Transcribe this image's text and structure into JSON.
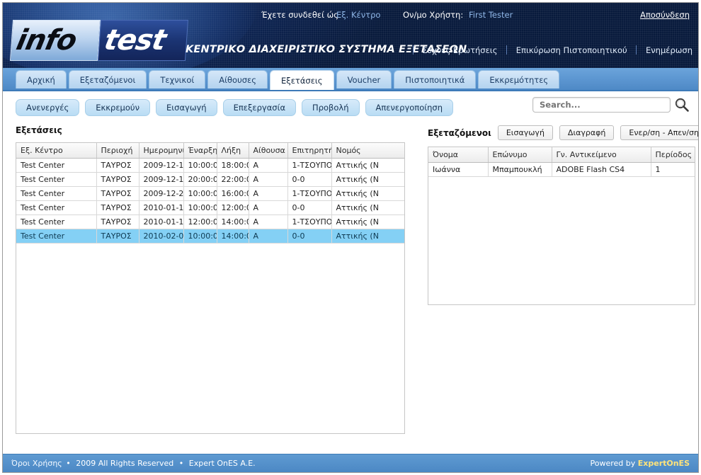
{
  "header": {
    "logo": {
      "part1": "info",
      "part2": "test"
    },
    "system_title": "ΚΕΝΤΡΙΚΟ ΔΙΑΧΕΙΡΙΣΤΙΚΟ ΣΥΣΤΗΜΑ ΕΞΕΤΑΣΕΩΝ",
    "connected_as_label": "Έχετε συνδεθεί ώς",
    "connected_as_value": "Εξ. Κέντρο",
    "username_label": "Ον/μο Χρήστη:",
    "username_value": "First Tester",
    "logout_label": "Αποσύνδεση",
    "links": [
      {
        "label": "Συχνές Ερωτήσεις"
      },
      {
        "label": "Επικύρωση Πιστοποιητικού"
      },
      {
        "label": "Ενημέρωση"
      }
    ]
  },
  "tabs": [
    {
      "label": "Αρχική",
      "active": false
    },
    {
      "label": "Εξεταζόμενοι",
      "active": false
    },
    {
      "label": "Τεχνικοί",
      "active": false
    },
    {
      "label": "Αίθουσες",
      "active": false
    },
    {
      "label": "Εξετάσεις",
      "active": true
    },
    {
      "label": "Voucher",
      "active": false
    },
    {
      "label": "Πιστοποιητικά",
      "active": false
    },
    {
      "label": "Εκκρεμότητες",
      "active": false
    }
  ],
  "toolbar": {
    "buttons": [
      {
        "label": "Ανενεργές"
      },
      {
        "label": "Εκκρεμούν"
      },
      {
        "label": "Εισαγωγή"
      },
      {
        "label": "Επεξεργασία"
      },
      {
        "label": "Προβολή"
      },
      {
        "label": "Απενεργοποίηση"
      }
    ]
  },
  "search": {
    "placeholder": "Search...",
    "value": "",
    "icon": "search-icon"
  },
  "exams_panel": {
    "title": "Εξετάσεις",
    "columns": [
      "Εξ. Κέντρο",
      "Περιοχή",
      "Ημερομηνί",
      "Έναρξη",
      "Λήξη",
      "Αίθουσα",
      "Επιτηρητής",
      "Νομός"
    ],
    "rows": [
      {
        "center": "Test Center",
        "area": "ΤΑΥΡΟΣ",
        "date": "2009-12-1",
        "start": "10:00:0",
        "end": "18:00:0",
        "room": "Α",
        "supervisor": "1-ΤΣΟΥΠΟ",
        "prefecture": "Αττικής (Ν",
        "selected": false
      },
      {
        "center": "Test Center",
        "area": "ΤΑΥΡΟΣ",
        "date": "2009-12-1",
        "start": "20:00:0",
        "end": "22:00:0",
        "room": "Α",
        "supervisor": "0-0",
        "prefecture": "Αττικής (Ν",
        "selected": false
      },
      {
        "center": "Test Center",
        "area": "ΤΑΥΡΟΣ",
        "date": "2009-12-2",
        "start": "10:00:0",
        "end": "16:00:0",
        "room": "Α",
        "supervisor": "1-ΤΣΟΥΠΟ",
        "prefecture": "Αττικής (Ν",
        "selected": false
      },
      {
        "center": "Test Center",
        "area": "ΤΑΥΡΟΣ",
        "date": "2010-01-1",
        "start": "10:00:0",
        "end": "12:00:0",
        "room": "Α",
        "supervisor": "0-0",
        "prefecture": "Αττικής (Ν",
        "selected": false
      },
      {
        "center": "Test Center",
        "area": "ΤΑΥΡΟΣ",
        "date": "2010-01-1",
        "start": "12:00:0",
        "end": "14:00:0",
        "room": "Α",
        "supervisor": "1-ΤΣΟΥΠΟ",
        "prefecture": "Αττικής (Ν",
        "selected": false
      },
      {
        "center": "Test Center",
        "area": "ΤΑΥΡΟΣ",
        "date": "2010-02-0",
        "start": "10:00:0",
        "end": "14:00:0",
        "room": "Α",
        "supervisor": "0-0",
        "prefecture": "Αττικής (Ν",
        "selected": true
      }
    ]
  },
  "candidates_panel": {
    "title": "Εξεταζόμενοι",
    "buttons": [
      {
        "label": "Εισαγωγή"
      },
      {
        "label": "Διαγραφή"
      },
      {
        "label": "Ενερ/ση - Απεν/ση"
      }
    ],
    "columns": [
      "Όνομα",
      "Επώνυμο",
      "Γν. Αντικείμενο",
      "Περίοδος"
    ],
    "rows": [
      {
        "first_name": "Ιωάννα",
        "last_name": "Μπαμπουκλή",
        "subject": "ADOBE Flash CS4",
        "period": "1"
      }
    ]
  },
  "footer": {
    "terms_label": "Όροι Χρήσης",
    "bullet": "•",
    "copyright": "2009 All Rights Reserved",
    "company": "Expert OnES A.E.",
    "powered_label": "Powered by",
    "powered_brand": "ExpertOnES"
  },
  "colors": {
    "header_navy": "#0a1d45",
    "tabbar_blue": "#5b95d0",
    "accent_button": "#b9dcf4",
    "row_selected": "#84d0f5",
    "footer_blue": "#4c88c4",
    "brand_gold": "#ffe37a"
  }
}
